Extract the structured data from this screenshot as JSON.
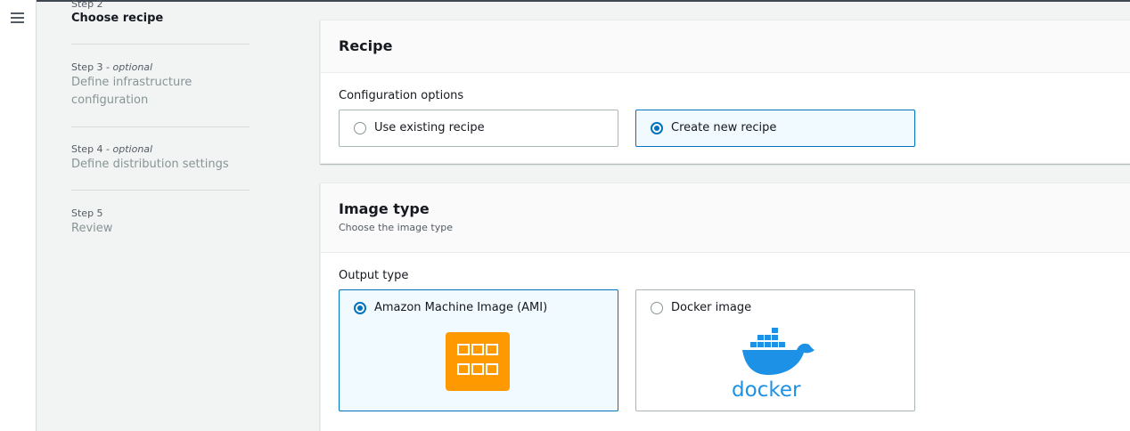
{
  "steps": [
    {
      "num": "Step 2",
      "optional": "",
      "title": "Choose recipe",
      "active": true
    },
    {
      "num": "Step 3",
      "optional": "optional",
      "title": "Define infrastructure configuration",
      "active": false
    },
    {
      "num": "Step 4",
      "optional": "optional",
      "title": "Define distribution settings",
      "active": false
    },
    {
      "num": "Step 5",
      "optional": "",
      "title": "Review",
      "active": false
    }
  ],
  "recipe_panel": {
    "title": "Recipe",
    "field_label": "Configuration options",
    "options": [
      {
        "label": "Use existing recipe",
        "selected": false
      },
      {
        "label": "Create new recipe",
        "selected": true
      }
    ]
  },
  "image_type_panel": {
    "title": "Image type",
    "description": "Choose the image type",
    "field_label": "Output type",
    "options": [
      {
        "label": "Amazon Machine Image (AMI)",
        "selected": true,
        "icon": "ami-icon"
      },
      {
        "label": "Docker image",
        "selected": false,
        "icon": "docker-logo"
      }
    ]
  },
  "docker_wordmark": "docker",
  "colors": {
    "accent": "#0073bb",
    "ami_orange": "#ff9900",
    "docker_blue": "#1d91e6"
  }
}
